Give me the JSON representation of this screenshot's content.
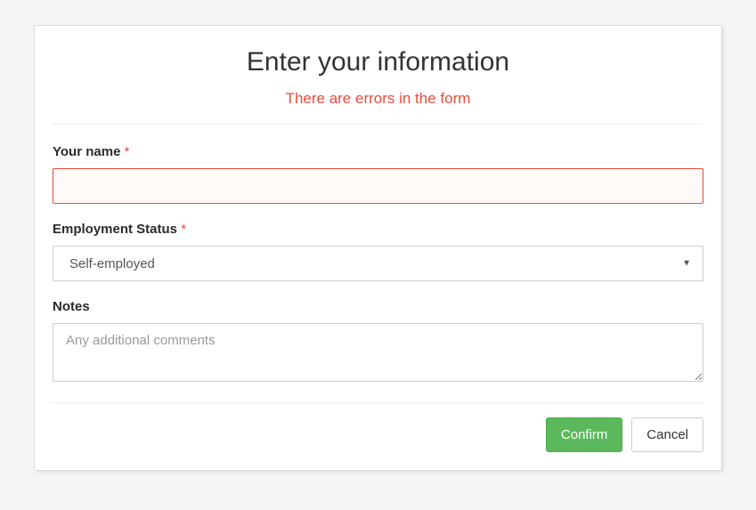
{
  "header": {
    "title": "Enter your information",
    "error_message": "There are errors in the form"
  },
  "form": {
    "name": {
      "label": "Your name",
      "required_mark": "*",
      "value": "",
      "has_error": true
    },
    "employment": {
      "label": "Employment Status",
      "required_mark": "*",
      "selected": "Self-employed"
    },
    "notes": {
      "label": "Notes",
      "placeholder": "Any additional comments",
      "value": ""
    }
  },
  "buttons": {
    "confirm": "Confirm",
    "cancel": "Cancel"
  }
}
